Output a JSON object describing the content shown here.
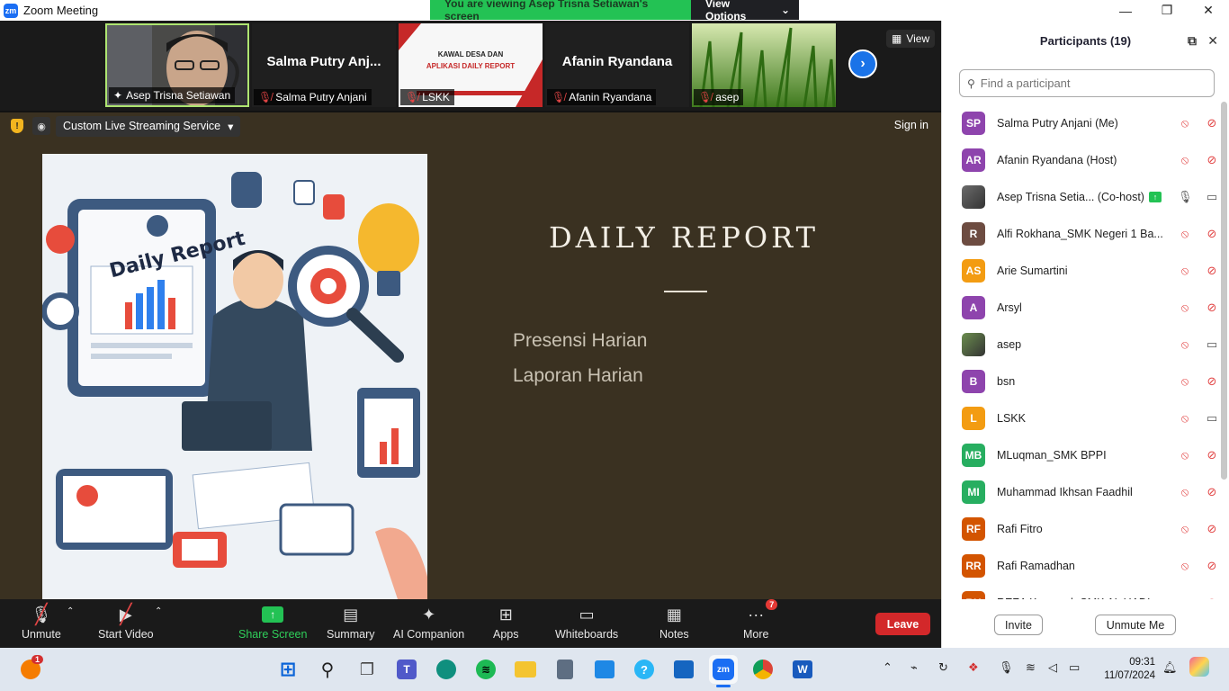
{
  "window": {
    "title": "Zoom Meeting",
    "logo_text": "zm"
  },
  "banner": {
    "message": "You are viewing Asep Trisna Setiawan's screen",
    "view_options": "View Options"
  },
  "thumbnails": {
    "tiles": [
      {
        "name": "Asep Trisna Setiawan",
        "type": "video"
      },
      {
        "name": "Salma Putry Anjani",
        "display": "Salma Putry Anj...",
        "type": "name"
      },
      {
        "name": "LSKK",
        "type": "slide",
        "slide_line1": "KAWAL DESA DAN",
        "slide_line2": "APLIKASI DAILY REPORT"
      },
      {
        "name": "Afanin Ryandana",
        "display": "Afanin Ryandana",
        "type": "name"
      },
      {
        "name": "asep",
        "type": "grass"
      }
    ],
    "view_label": "View"
  },
  "stage": {
    "stream_service": "Custom Live Streaming Service",
    "sign_in": "Sign in",
    "slide": {
      "title": "DAILY REPORT",
      "items": [
        "Presensi Harian",
        "Laporan Harian"
      ],
      "image_text": "Daily Report"
    }
  },
  "toolbar": {
    "unmute": "Unmute",
    "start_video": "Start Video",
    "share_screen": "Share Screen",
    "summary": "Summary",
    "ai_companion": "AI Companion",
    "apps": "Apps",
    "whiteboards": "Whiteboards",
    "notes": "Notes",
    "more": "More",
    "more_badge": "7",
    "leave": "Leave"
  },
  "participants": {
    "header": "Participants (19)",
    "search_placeholder": "Find a participant",
    "list": [
      {
        "initials": "SP",
        "name": "Salma Putry Anjani (Me)",
        "color": "#8e44ad",
        "mic": "off",
        "video": "off"
      },
      {
        "initials": "AR",
        "name": "Afanin Ryandana (Host)",
        "color": "#8e44ad",
        "mic": "off",
        "video": "off"
      },
      {
        "initials": "",
        "name": "Asep Trisna Setia... (Co-host)",
        "color": "#6b6b6b",
        "mic": "on",
        "video": "on",
        "sharing": true,
        "photo": true
      },
      {
        "initials": "R",
        "name": "Alfi Rokhana_SMK Negeri 1 Ba...",
        "color": "#6d4c41",
        "mic": "off",
        "video": "off"
      },
      {
        "initials": "AS",
        "name": "Arie Sumartini",
        "color": "#f39c12",
        "mic": "off",
        "video": "off"
      },
      {
        "initials": "A",
        "name": "Arsyl",
        "color": "#8e44ad",
        "mic": "off",
        "video": "off"
      },
      {
        "initials": "",
        "name": "asep",
        "color": "#6b8e4e",
        "mic": "off",
        "video": "on",
        "photo": true
      },
      {
        "initials": "B",
        "name": "bsn",
        "color": "#8e44ad",
        "mic": "off",
        "video": "off"
      },
      {
        "initials": "L",
        "name": "LSKK",
        "color": "#f39c12",
        "mic": "off",
        "video": "on"
      },
      {
        "initials": "MB",
        "name": "MLuqman_SMK BPPI",
        "color": "#27ae60",
        "mic": "off",
        "video": "off"
      },
      {
        "initials": "MI",
        "name": "Muhammad Ikhsan Faadhil",
        "color": "#27ae60",
        "mic": "off",
        "video": "off"
      },
      {
        "initials": "RF",
        "name": "Rafi Fitro",
        "color": "#d35400",
        "mic": "off",
        "video": "off"
      },
      {
        "initials": "RR",
        "name": "Rafi Ramadhan",
        "color": "#d35400",
        "mic": "off",
        "video": "off"
      },
      {
        "initials": "RK",
        "name": "REZA Kusumah SMK AL HADI",
        "color": "#d35400",
        "mic": "off",
        "video": "off"
      }
    ],
    "invite": "Invite",
    "unmute_me": "Unmute Me"
  },
  "taskbar": {
    "notification_badge": "1",
    "time": "09:31",
    "date": "11/07/2024"
  }
}
